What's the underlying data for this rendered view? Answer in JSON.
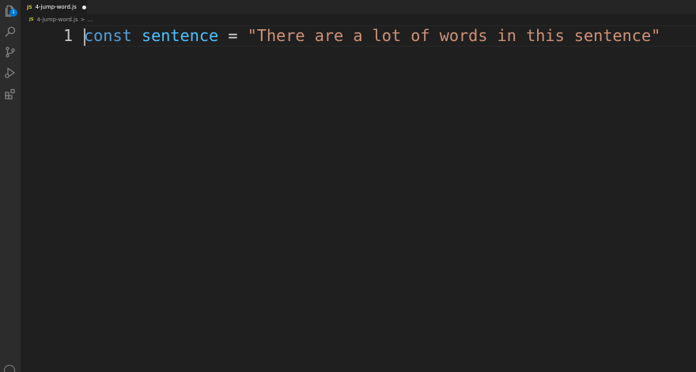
{
  "activity_bar": {
    "explorer_badge": "1",
    "items": [
      "files-icon",
      "search-icon",
      "source-control-icon",
      "run-debug-icon",
      "extensions-icon"
    ]
  },
  "tabs": [
    {
      "icon": "JS",
      "label": "4-jump-word.js",
      "dirty": true,
      "active": true
    }
  ],
  "breadcrumb": {
    "icon": "JS",
    "file": "4-jump-word.js",
    "separator": ">",
    "ellipsis": "..."
  },
  "editor": {
    "lines": [
      {
        "number": "1",
        "tokens": {
          "keyword": "const",
          "space1": " ",
          "var": "sentence",
          "space2": " ",
          "op": "=",
          "space3": " ",
          "string": "\"There are a lot of words in this sentence\""
        }
      }
    ]
  },
  "colors": {
    "keyword": "#569cd6",
    "variable": "#4fc1ff",
    "operator": "#d4d4d4",
    "string": "#ce9178",
    "js_icon": "#cbcb41",
    "badge": "#0078d4"
  }
}
